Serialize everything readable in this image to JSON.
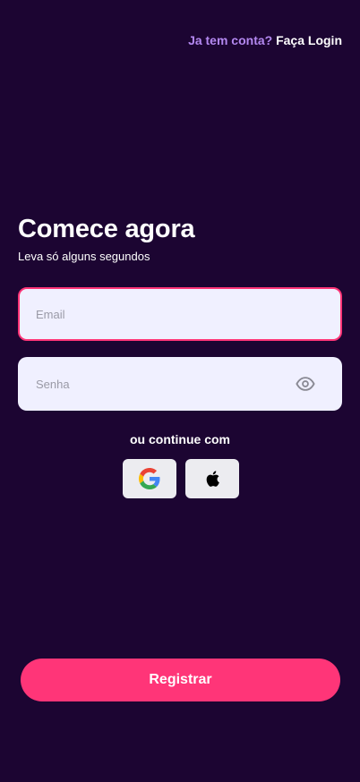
{
  "header": {
    "question": "Ja tem conta?",
    "login_link": "Faça Login"
  },
  "main": {
    "title": "Comece agora",
    "subtitle": "Leva só alguns segundos"
  },
  "form": {
    "email": {
      "value": "",
      "placeholder": "Email"
    },
    "password": {
      "value": "",
      "placeholder": "Senha",
      "toggle_icon": "eye-icon"
    }
  },
  "social": {
    "label": "ou continue com",
    "providers": [
      {
        "name": "google",
        "icon": "google-icon"
      },
      {
        "name": "apple",
        "icon": "apple-icon"
      }
    ]
  },
  "actions": {
    "register_label": "Registrar"
  },
  "colors": {
    "background": "#1c0532",
    "accent": "#ff3578",
    "link_muted": "#b388f0",
    "field_bg": "#f0f0ff",
    "social_bg": "#ececf0"
  }
}
